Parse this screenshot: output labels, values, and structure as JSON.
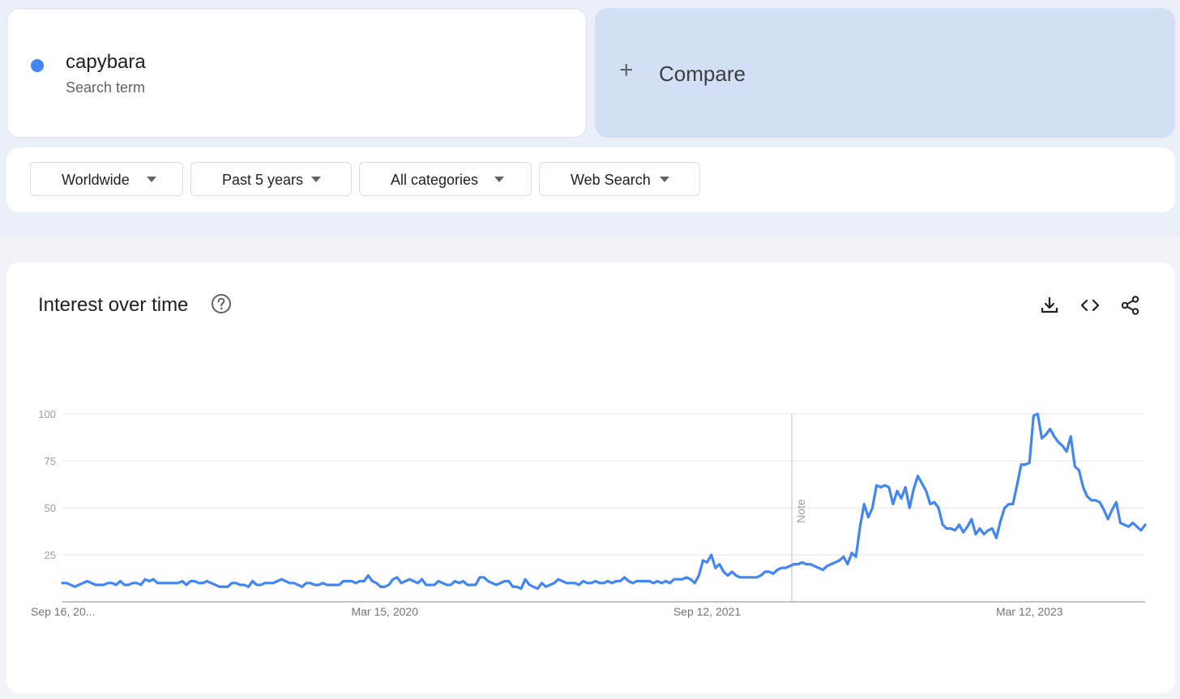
{
  "search_term": {
    "name": "capybara",
    "subtitle": "Search term",
    "color": "#4285f4"
  },
  "compare": {
    "plus": "+",
    "label": "Compare"
  },
  "filters": [
    {
      "label": "Worldwide"
    },
    {
      "label": "Past 5 years"
    },
    {
      "label": "All categories"
    },
    {
      "label": "Web Search"
    }
  ],
  "chart_section": {
    "title": "Interest over time",
    "icons": [
      "help-icon",
      "download-icon",
      "embed-icon",
      "share-icon"
    ]
  },
  "chart_data": {
    "type": "line",
    "title": "Interest over time",
    "xlabel": "",
    "ylabel": "",
    "ylim": [
      0,
      100
    ],
    "yticks": [
      25,
      50,
      75,
      100
    ],
    "grid": true,
    "line_color": "#4285f4",
    "x_tick_labels": [
      "Sep 16, 20...",
      "Mar 15, 2020",
      "Sep 12, 2021",
      "Mar 12, 2023"
    ],
    "annotation": {
      "label": "Note",
      "x": "Jan 2022"
    },
    "series": [
      {
        "values": [
          10,
          10,
          9,
          8,
          9,
          10,
          11,
          10,
          9,
          9,
          9,
          10,
          10,
          9,
          11,
          9,
          9,
          10,
          10,
          9,
          12,
          11,
          12,
          10,
          10,
          10,
          10,
          10,
          10,
          11,
          9,
          11,
          11,
          10,
          10,
          11,
          10,
          9,
          8,
          8,
          8,
          10,
          10,
          9,
          9,
          8,
          11,
          9,
          9,
          10,
          10,
          10,
          11,
          12,
          11,
          10,
          10,
          9,
          8,
          10,
          10,
          9,
          9,
          10,
          9,
          9,
          9,
          9,
          11,
          11,
          11,
          10,
          11,
          11,
          14,
          11,
          10,
          8,
          8,
          9,
          12,
          13,
          10,
          11,
          12,
          11,
          10,
          12,
          9,
          9,
          9,
          11,
          10,
          9,
          9,
          11,
          10,
          11,
          9,
          9,
          9,
          13,
          13,
          11,
          10,
          9,
          10,
          11,
          11,
          8,
          8,
          7,
          12,
          9,
          8,
          7,
          10,
          8,
          9,
          10,
          12,
          11,
          10,
          10,
          10,
          9,
          11,
          10,
          10,
          11,
          10,
          10,
          11,
          10,
          11,
          11,
          13,
          11,
          10,
          11,
          11,
          11,
          11,
          10,
          11,
          10,
          11,
          10,
          12,
          12,
          12,
          13,
          12,
          10,
          14,
          22,
          21,
          25,
          18,
          20,
          16,
          14,
          16,
          14,
          13,
          13,
          13,
          13,
          13,
          14,
          16,
          16,
          15,
          17,
          18,
          18,
          19,
          20,
          20,
          21,
          20,
          20,
          19,
          18,
          17,
          19,
          20,
          21,
          22,
          24,
          20,
          26,
          24,
          40,
          52,
          45,
          50,
          62,
          61,
          62,
          61,
          52,
          59,
          55,
          61,
          50,
          60,
          67,
          63,
          59,
          52,
          53,
          50,
          41,
          39,
          39,
          38,
          41,
          37,
          40,
          44,
          36,
          39,
          36,
          38,
          39,
          34,
          43,
          50,
          52,
          52,
          62,
          73,
          73,
          74,
          99,
          100,
          87,
          89,
          92,
          88,
          85,
          83,
          80,
          88,
          72,
          70,
          61,
          56,
          54,
          54,
          53,
          49,
          44,
          49,
          53,
          42,
          41,
          40,
          42,
          40,
          38,
          41
        ]
      }
    ]
  }
}
